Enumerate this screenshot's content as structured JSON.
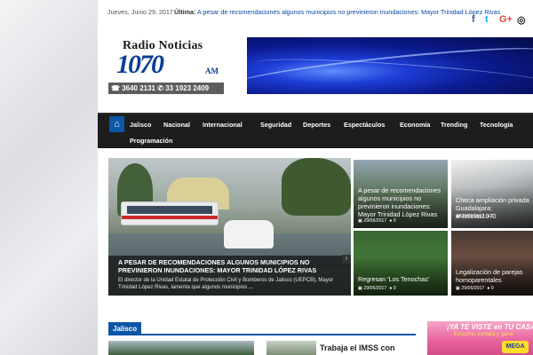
{
  "topbar": {
    "date": "Jueves, Junio 29, 2017",
    "ultima_label": "Última:",
    "headline": "A pesar de recomendaciones algunos municipios no previnieron inundaciones: Mayor Trinidad López Rivas",
    "social": [
      {
        "icon": "facebook-icon",
        "glyph": "f",
        "color": "#3b5998"
      },
      {
        "icon": "twitter-icon",
        "glyph": "t",
        "color": "#1da1f2"
      },
      {
        "icon": "google-plus-icon",
        "glyph": "G+",
        "color": "#dd4b39"
      },
      {
        "icon": "instagram-icon",
        "glyph": "◎",
        "color": "#222222"
      }
    ]
  },
  "logo": {
    "line1": "Radio Noticias",
    "line2": "1070",
    "am": "AM",
    "phones": "☎ 3640 2131   ✆ 33 1923 2409"
  },
  "nav": {
    "home_icon": "home-icon",
    "items": [
      "Jalisco",
      "Nacional",
      "Internacional",
      "Seguridad",
      "Deportes",
      "Espectáculos",
      "Economía",
      "Trending",
      "Tecnología",
      "Programación"
    ]
  },
  "hero": {
    "title": "A pesar de recomendaciones algunos municipios no previnieron inundaciones: Mayor Trinidad López Rivas",
    "description": "El director de la Unidad Estatal de Protección Civil y Bomberos de Jalisco (UEPCB), Mayor Trinidad López Rivas, lamenta que algunos municipios ...",
    "arrow": "›"
  },
  "cards": [
    {
      "title": "A pesar de recomendaciones algunos municipios no previnieron inundaciones: Mayor Trinidad López Rivas",
      "date": "29/06/2017",
      "comments": "0"
    },
    {
      "title": "Checa ampliación privada Guadalajara: #Noticias1070",
      "date": "29/06/2017",
      "comments": "0"
    },
    {
      "title": "Regresan 'Los Tenochas'",
      "date": "29/06/2017",
      "comments": "0"
    },
    {
      "title": "Legalización de parejas homoparentales",
      "date": "29/06/2017",
      "comments": "0"
    }
  ],
  "section": {
    "tag": "Jalisco",
    "side_title": "Trabaja el IMSS con"
  },
  "ad": {
    "line1": "¡YA TE VISTE en TU CASA PROPIA?",
    "line2": "Escucha, compra y gana",
    "badge": "MEGA"
  },
  "colors": {
    "accent": "#0b56a7",
    "nav_bg": "#1d1d1d"
  }
}
